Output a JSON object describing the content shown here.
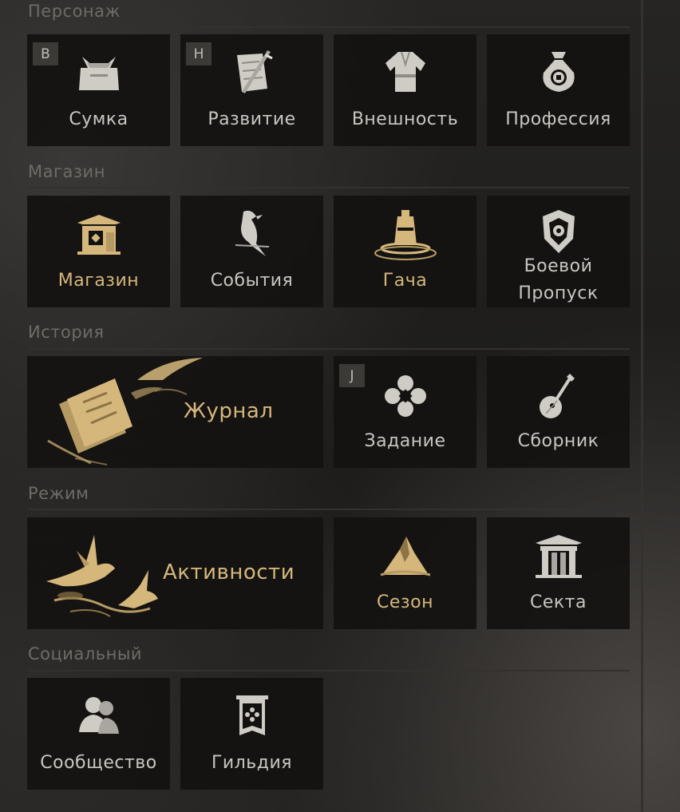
{
  "sections": {
    "character": "Персонаж",
    "shop": "Магазин",
    "story": "История",
    "mode": "Режим",
    "social": "Социальный"
  },
  "tiles": {
    "bag": {
      "label": "Сумка",
      "hotkey": "B",
      "icon": "bag-icon"
    },
    "growth": {
      "label": "Развитие",
      "hotkey": "H",
      "icon": "sword-scroll-icon"
    },
    "appearance": {
      "label": "Внешность",
      "icon": "robe-icon"
    },
    "profession": {
      "label": "Профессия",
      "icon": "money-bag-icon"
    },
    "shop": {
      "label": "Магазин",
      "icon": "pagoda-shop-icon"
    },
    "events": {
      "label": "События",
      "icon": "bird-icon"
    },
    "gacha": {
      "label": "Гача",
      "icon": "bell-icon"
    },
    "battlepass": {
      "label_line1": "Боевой",
      "label_line2": "Пропуск",
      "icon": "shield-icon"
    },
    "journal": {
      "label": "Журнал",
      "icon": "scrolls-icon"
    },
    "quest": {
      "label": "Задание",
      "hotkey": "J",
      "icon": "flower-icon"
    },
    "collection": {
      "label": "Сборник",
      "icon": "lute-icon"
    },
    "activities": {
      "label": "Активности",
      "icon": "cranes-icon"
    },
    "season": {
      "label": "Сезон",
      "icon": "mountain-icon"
    },
    "sect": {
      "label": "Секта",
      "icon": "gate-icon"
    },
    "community": {
      "label": "Сообщество",
      "icon": "people-icon"
    },
    "guild": {
      "label": "Гильдия",
      "icon": "banner-icon"
    }
  },
  "colors": {
    "gold": "#d5b77c",
    "silver": "#c9c6c1",
    "tile_bg": "#131211"
  }
}
